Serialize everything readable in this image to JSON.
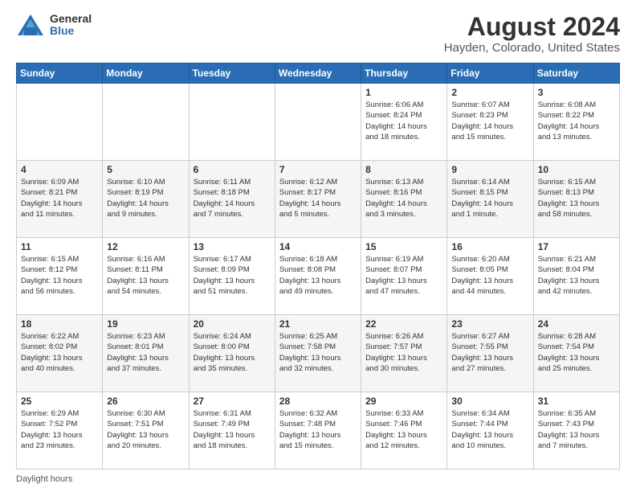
{
  "logo": {
    "general": "General",
    "blue": "Blue"
  },
  "title": "August 2024",
  "subtitle": "Hayden, Colorado, United States",
  "footer": "Daylight hours",
  "days_of_week": [
    "Sunday",
    "Monday",
    "Tuesday",
    "Wednesday",
    "Thursday",
    "Friday",
    "Saturday"
  ],
  "weeks": [
    [
      {
        "day": "",
        "info": ""
      },
      {
        "day": "",
        "info": ""
      },
      {
        "day": "",
        "info": ""
      },
      {
        "day": "",
        "info": ""
      },
      {
        "day": "1",
        "info": "Sunrise: 6:06 AM\nSunset: 8:24 PM\nDaylight: 14 hours\nand 18 minutes."
      },
      {
        "day": "2",
        "info": "Sunrise: 6:07 AM\nSunset: 8:23 PM\nDaylight: 14 hours\nand 15 minutes."
      },
      {
        "day": "3",
        "info": "Sunrise: 6:08 AM\nSunset: 8:22 PM\nDaylight: 14 hours\nand 13 minutes."
      }
    ],
    [
      {
        "day": "4",
        "info": "Sunrise: 6:09 AM\nSunset: 8:21 PM\nDaylight: 14 hours\nand 11 minutes."
      },
      {
        "day": "5",
        "info": "Sunrise: 6:10 AM\nSunset: 8:19 PM\nDaylight: 14 hours\nand 9 minutes."
      },
      {
        "day": "6",
        "info": "Sunrise: 6:11 AM\nSunset: 8:18 PM\nDaylight: 14 hours\nand 7 minutes."
      },
      {
        "day": "7",
        "info": "Sunrise: 6:12 AM\nSunset: 8:17 PM\nDaylight: 14 hours\nand 5 minutes."
      },
      {
        "day": "8",
        "info": "Sunrise: 6:13 AM\nSunset: 8:16 PM\nDaylight: 14 hours\nand 3 minutes."
      },
      {
        "day": "9",
        "info": "Sunrise: 6:14 AM\nSunset: 8:15 PM\nDaylight: 14 hours\nand 1 minute."
      },
      {
        "day": "10",
        "info": "Sunrise: 6:15 AM\nSunset: 8:13 PM\nDaylight: 13 hours\nand 58 minutes."
      }
    ],
    [
      {
        "day": "11",
        "info": "Sunrise: 6:15 AM\nSunset: 8:12 PM\nDaylight: 13 hours\nand 56 minutes."
      },
      {
        "day": "12",
        "info": "Sunrise: 6:16 AM\nSunset: 8:11 PM\nDaylight: 13 hours\nand 54 minutes."
      },
      {
        "day": "13",
        "info": "Sunrise: 6:17 AM\nSunset: 8:09 PM\nDaylight: 13 hours\nand 51 minutes."
      },
      {
        "day": "14",
        "info": "Sunrise: 6:18 AM\nSunset: 8:08 PM\nDaylight: 13 hours\nand 49 minutes."
      },
      {
        "day": "15",
        "info": "Sunrise: 6:19 AM\nSunset: 8:07 PM\nDaylight: 13 hours\nand 47 minutes."
      },
      {
        "day": "16",
        "info": "Sunrise: 6:20 AM\nSunset: 8:05 PM\nDaylight: 13 hours\nand 44 minutes."
      },
      {
        "day": "17",
        "info": "Sunrise: 6:21 AM\nSunset: 8:04 PM\nDaylight: 13 hours\nand 42 minutes."
      }
    ],
    [
      {
        "day": "18",
        "info": "Sunrise: 6:22 AM\nSunset: 8:02 PM\nDaylight: 13 hours\nand 40 minutes."
      },
      {
        "day": "19",
        "info": "Sunrise: 6:23 AM\nSunset: 8:01 PM\nDaylight: 13 hours\nand 37 minutes."
      },
      {
        "day": "20",
        "info": "Sunrise: 6:24 AM\nSunset: 8:00 PM\nDaylight: 13 hours\nand 35 minutes."
      },
      {
        "day": "21",
        "info": "Sunrise: 6:25 AM\nSunset: 7:58 PM\nDaylight: 13 hours\nand 32 minutes."
      },
      {
        "day": "22",
        "info": "Sunrise: 6:26 AM\nSunset: 7:57 PM\nDaylight: 13 hours\nand 30 minutes."
      },
      {
        "day": "23",
        "info": "Sunrise: 6:27 AM\nSunset: 7:55 PM\nDaylight: 13 hours\nand 27 minutes."
      },
      {
        "day": "24",
        "info": "Sunrise: 6:28 AM\nSunset: 7:54 PM\nDaylight: 13 hours\nand 25 minutes."
      }
    ],
    [
      {
        "day": "25",
        "info": "Sunrise: 6:29 AM\nSunset: 7:52 PM\nDaylight: 13 hours\nand 23 minutes."
      },
      {
        "day": "26",
        "info": "Sunrise: 6:30 AM\nSunset: 7:51 PM\nDaylight: 13 hours\nand 20 minutes."
      },
      {
        "day": "27",
        "info": "Sunrise: 6:31 AM\nSunset: 7:49 PM\nDaylight: 13 hours\nand 18 minutes."
      },
      {
        "day": "28",
        "info": "Sunrise: 6:32 AM\nSunset: 7:48 PM\nDaylight: 13 hours\nand 15 minutes."
      },
      {
        "day": "29",
        "info": "Sunrise: 6:33 AM\nSunset: 7:46 PM\nDaylight: 13 hours\nand 12 minutes."
      },
      {
        "day": "30",
        "info": "Sunrise: 6:34 AM\nSunset: 7:44 PM\nDaylight: 13 hours\nand 10 minutes."
      },
      {
        "day": "31",
        "info": "Sunrise: 6:35 AM\nSunset: 7:43 PM\nDaylight: 13 hours\nand 7 minutes."
      }
    ]
  ]
}
